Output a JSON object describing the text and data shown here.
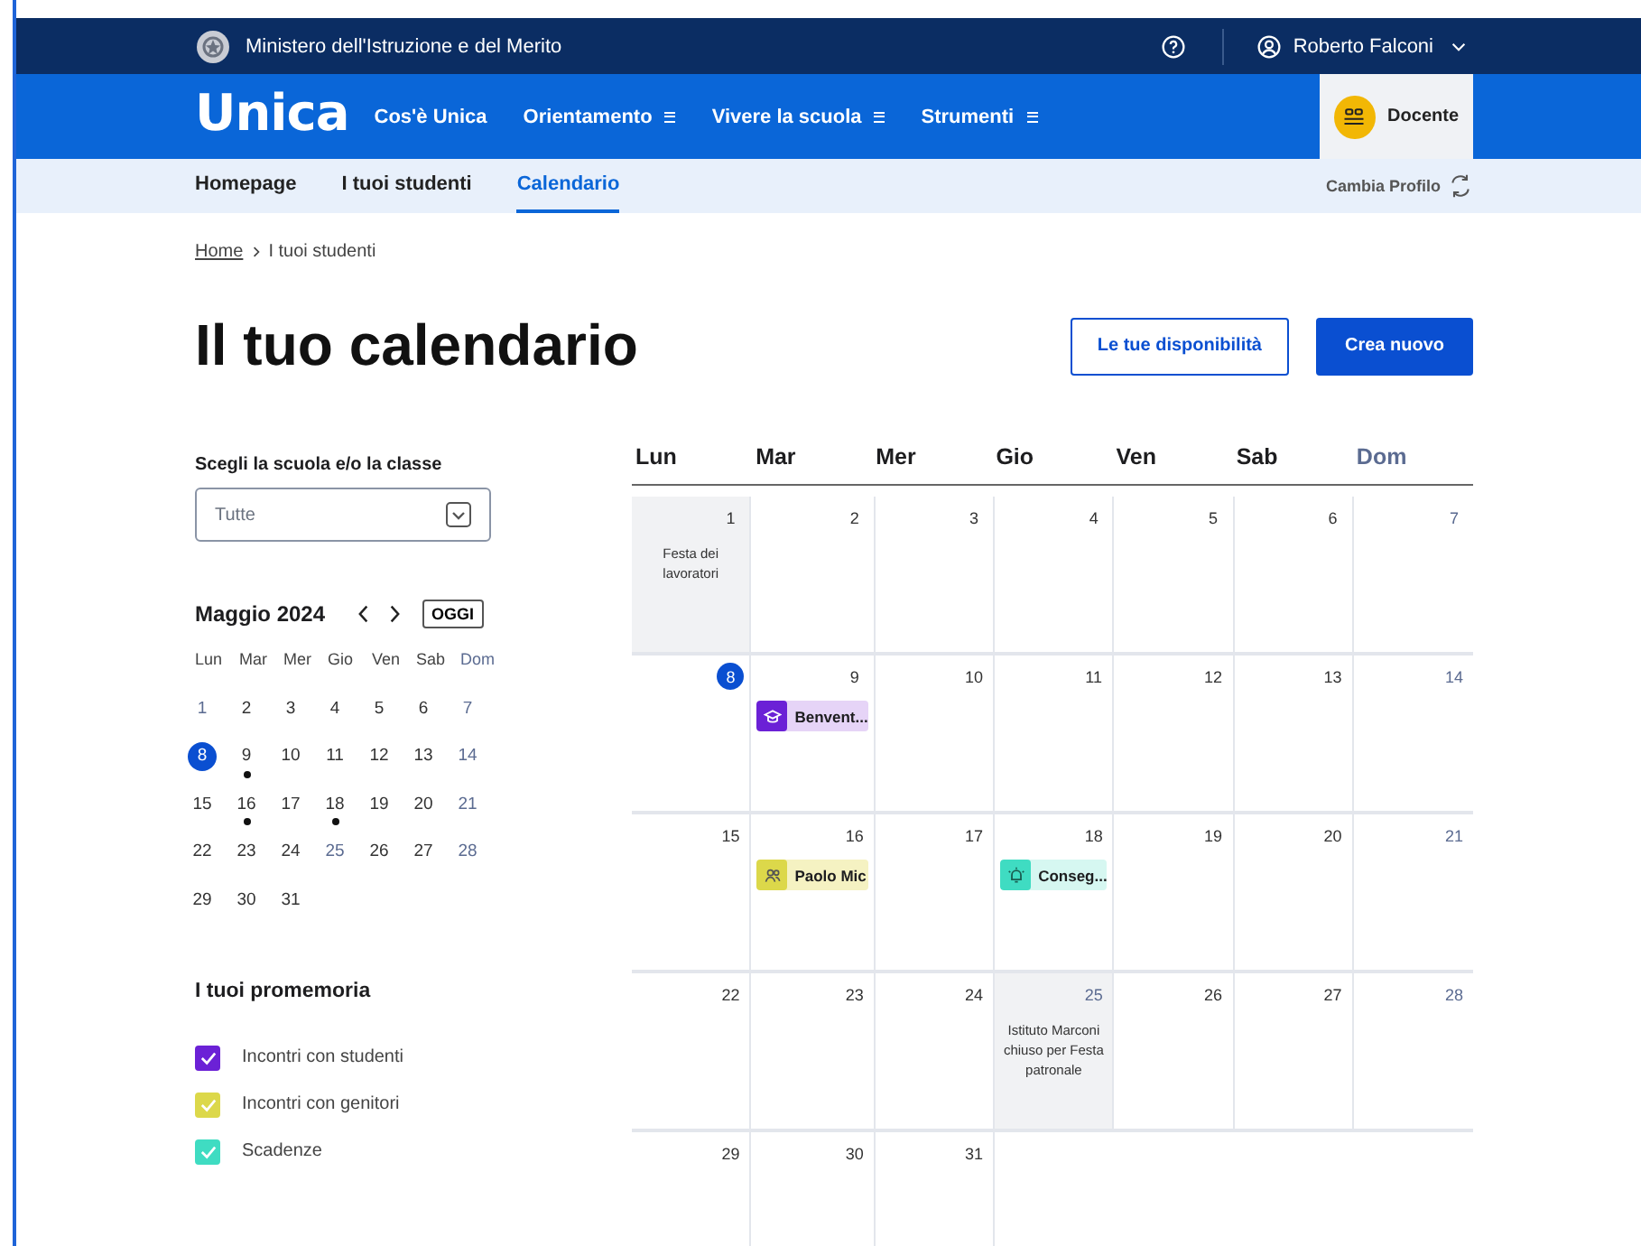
{
  "top_bar": {
    "ministry": "Ministero dell'Istruzione e del Merito",
    "user": "Roberto Falconi"
  },
  "nav": {
    "logo": "Unica",
    "items": [
      {
        "label": "Cos'è Unica",
        "menu": false
      },
      {
        "label": "Orientamento",
        "menu": true
      },
      {
        "label": "Vivere la scuola",
        "menu": true
      },
      {
        "label": "Strumenti",
        "menu": true
      }
    ],
    "profile": "Docente"
  },
  "sub_nav": {
    "tabs": [
      {
        "label": "Homepage",
        "selected": false
      },
      {
        "label": "I tuoi studenti",
        "selected": false
      },
      {
        "label": "Calendario",
        "selected": true
      }
    ],
    "switch_profile": "Cambia Profilo"
  },
  "breadcrumb": [
    {
      "label": "Home",
      "link": true
    },
    {
      "label": "I tuoi studenti",
      "link": false
    }
  ],
  "title": "Il tuo calendario",
  "buttons": [
    {
      "label": "Le tue disponibilità",
      "kind": "secondary"
    },
    {
      "label": "Crea nuovo",
      "kind": "primary"
    }
  ],
  "filter": {
    "label": "Scegli la scuola e/o la classe",
    "value": "Tutte"
  },
  "mini_calendar": {
    "title": "Maggio 2024",
    "today_button": "OGGI",
    "weekdays": [
      {
        "label": "Lun",
        "holiday": false
      },
      {
        "label": "Mar",
        "holiday": false
      },
      {
        "label": "Mer",
        "holiday": false
      },
      {
        "label": "Gio",
        "holiday": false
      },
      {
        "label": "Ven",
        "holiday": false
      },
      {
        "label": "Sab",
        "holiday": false
      },
      {
        "label": "Dom",
        "holiday": true
      }
    ],
    "days": [
      {
        "day": "1",
        "holiday": true,
        "event": false,
        "selected": false
      },
      {
        "day": "2",
        "holiday": false,
        "event": false,
        "selected": false
      },
      {
        "day": "3",
        "holiday": false,
        "event": false,
        "selected": false
      },
      {
        "day": "4",
        "holiday": false,
        "event": false,
        "selected": false
      },
      {
        "day": "5",
        "holiday": false,
        "event": false,
        "selected": false
      },
      {
        "day": "6",
        "holiday": false,
        "event": false,
        "selected": false
      },
      {
        "day": "7",
        "holiday": true,
        "event": false,
        "selected": false
      },
      {
        "day": "8",
        "holiday": false,
        "event": false,
        "selected": true
      },
      {
        "day": "9",
        "holiday": false,
        "event": true,
        "selected": false
      },
      {
        "day": "10",
        "holiday": false,
        "event": false,
        "selected": false
      },
      {
        "day": "11",
        "holiday": false,
        "event": false,
        "selected": false
      },
      {
        "day": "12",
        "holiday": false,
        "event": false,
        "selected": false
      },
      {
        "day": "13",
        "holiday": false,
        "event": false,
        "selected": false
      },
      {
        "day": "14",
        "holiday": true,
        "event": false,
        "selected": false
      },
      {
        "day": "15",
        "holiday": false,
        "event": false,
        "selected": false
      },
      {
        "day": "16",
        "holiday": false,
        "event": true,
        "selected": false
      },
      {
        "day": "17",
        "holiday": false,
        "event": false,
        "selected": false
      },
      {
        "day": "18",
        "holiday": false,
        "event": true,
        "selected": false
      },
      {
        "day": "19",
        "holiday": false,
        "event": false,
        "selected": false
      },
      {
        "day": "20",
        "holiday": false,
        "event": false,
        "selected": false
      },
      {
        "day": "21",
        "holiday": true,
        "event": false,
        "selected": false
      },
      {
        "day": "22",
        "holiday": false,
        "event": false,
        "selected": false
      },
      {
        "day": "23",
        "holiday": false,
        "event": false,
        "selected": false
      },
      {
        "day": "24",
        "holiday": false,
        "event": false,
        "selected": false
      },
      {
        "day": "25",
        "holiday": true,
        "event": false,
        "selected": false
      },
      {
        "day": "26",
        "holiday": false,
        "event": false,
        "selected": false
      },
      {
        "day": "27",
        "holiday": false,
        "event": false,
        "selected": false
      },
      {
        "day": "28",
        "holiday": true,
        "event": false,
        "selected": false
      },
      {
        "day": "29",
        "holiday": false,
        "event": false,
        "selected": false
      },
      {
        "day": "30",
        "holiday": false,
        "event": false,
        "selected": false
      },
      {
        "day": "31",
        "holiday": false,
        "event": false,
        "selected": false
      }
    ]
  },
  "reminders": {
    "title": "I tuoi promemoria",
    "items": [
      {
        "label": "Incontri con studenti",
        "checked": true,
        "color": "#6b21d6"
      },
      {
        "label": "Incontri con genitori",
        "checked": true,
        "color": "#dcd84a"
      },
      {
        "label": "Scadenze",
        "checked": true,
        "color": "#3fdcc2"
      }
    ]
  },
  "calendar": {
    "weekdays": [
      {
        "label": "Lun",
        "holiday": false
      },
      {
        "label": "Mar",
        "holiday": false
      },
      {
        "label": "Mer",
        "holiday": false
      },
      {
        "label": "Gio",
        "holiday": false
      },
      {
        "label": "Ven",
        "holiday": false
      },
      {
        "label": "Sab",
        "holiday": false
      },
      {
        "label": "Dom",
        "holiday": true
      }
    ],
    "days": [
      {
        "day": "1",
        "holiday": false,
        "shaded": true,
        "selected": false,
        "note": "Festa dei lavoratori"
      },
      {
        "day": "2",
        "holiday": false,
        "shaded": false,
        "selected": false
      },
      {
        "day": "3",
        "holiday": false,
        "shaded": false,
        "selected": false
      },
      {
        "day": "4",
        "holiday": false,
        "shaded": false,
        "selected": false
      },
      {
        "day": "5",
        "holiday": false,
        "shaded": false,
        "selected": false
      },
      {
        "day": "6",
        "holiday": false,
        "shaded": false,
        "selected": false
      },
      {
        "day": "7",
        "holiday": true,
        "shaded": false,
        "selected": false
      },
      {
        "day": "8",
        "holiday": false,
        "shaded": false,
        "selected": true
      },
      {
        "day": "9",
        "holiday": false,
        "shaded": false,
        "selected": false,
        "events": [
          {
            "kind": "students",
            "title": "Benvent..."
          }
        ]
      },
      {
        "day": "10",
        "holiday": false,
        "shaded": false,
        "selected": false
      },
      {
        "day": "11",
        "holiday": false,
        "shaded": false,
        "selected": false
      },
      {
        "day": "12",
        "holiday": false,
        "shaded": false,
        "selected": false
      },
      {
        "day": "13",
        "holiday": false,
        "shaded": false,
        "selected": false
      },
      {
        "day": "14",
        "holiday": true,
        "shaded": false,
        "selected": false
      },
      {
        "day": "15",
        "holiday": false,
        "shaded": false,
        "selected": false
      },
      {
        "day": "16",
        "holiday": false,
        "shaded": false,
        "selected": false,
        "events": [
          {
            "kind": "parents",
            "title": "Paolo Mic"
          }
        ]
      },
      {
        "day": "17",
        "holiday": false,
        "shaded": false,
        "selected": false
      },
      {
        "day": "18",
        "holiday": false,
        "shaded": false,
        "selected": false,
        "events": [
          {
            "kind": "deadline",
            "title": "Conseg..."
          }
        ]
      },
      {
        "day": "19",
        "holiday": false,
        "shaded": false,
        "selected": false
      },
      {
        "day": "20",
        "holiday": false,
        "shaded": false,
        "selected": false
      },
      {
        "day": "21",
        "holiday": true,
        "shaded": false,
        "selected": false
      },
      {
        "day": "22",
        "holiday": false,
        "shaded": false,
        "selected": false
      },
      {
        "day": "23",
        "holiday": false,
        "shaded": false,
        "selected": false
      },
      {
        "day": "24",
        "holiday": false,
        "shaded": false,
        "selected": false
      },
      {
        "day": "25",
        "holiday": true,
        "shaded": true,
        "selected": false,
        "note": "Istituto Marconi chiuso per Festa patronale"
      },
      {
        "day": "26",
        "holiday": false,
        "shaded": false,
        "selected": false
      },
      {
        "day": "27",
        "holiday": false,
        "shaded": false,
        "selected": false
      },
      {
        "day": "28",
        "holiday": true,
        "shaded": false,
        "selected": false
      },
      {
        "day": "29",
        "holiday": false,
        "shaded": false,
        "selected": false
      },
      {
        "day": "30",
        "holiday": false,
        "shaded": false,
        "selected": false
      },
      {
        "day": "31",
        "holiday": false,
        "shaded": false,
        "selected": false
      }
    ]
  }
}
